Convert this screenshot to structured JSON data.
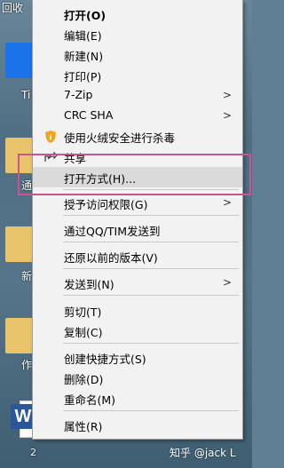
{
  "desktop": {
    "labels": [
      "回收",
      "Ti",
      "通",
      "新",
      "作",
      "2"
    ],
    "word_tile": "W",
    "watermark": "知乎 @jack L"
  },
  "menu": {
    "items": [
      {
        "label": "打开(O)",
        "bold": true
      },
      {
        "label": "编辑(E)"
      },
      {
        "label": "新建(N)"
      },
      {
        "label": "打印(P)"
      },
      {
        "label": "7-Zip",
        "submenu": true
      },
      {
        "label": "CRC SHA",
        "submenu": true
      },
      {
        "label": "使用火绒安全进行杀毒",
        "icon": "huorong-shield-icon"
      },
      {
        "label": "共享",
        "icon": "share-icon"
      },
      {
        "label": "打开方式(H)...",
        "highlighted": true
      },
      {
        "label": "授予访问权限(G)",
        "submenu": true
      },
      {
        "label": "通过QQ/TIM发送到"
      },
      {
        "label": "还原以前的版本(V)"
      },
      {
        "label": "发送到(N)",
        "submenu": true
      },
      {
        "label": "剪切(T)"
      },
      {
        "label": "复制(C)"
      },
      {
        "label": "创建快捷方式(S)"
      },
      {
        "label": "删除(D)"
      },
      {
        "label": "重命名(M)"
      },
      {
        "label": "属性(R)"
      }
    ],
    "submenu_arrow": ">"
  },
  "colors": {
    "menu_bg": "#f2f2f2",
    "highlight": "#dadada",
    "annotation": "#c9548e",
    "word_blue": "#2b579a"
  }
}
